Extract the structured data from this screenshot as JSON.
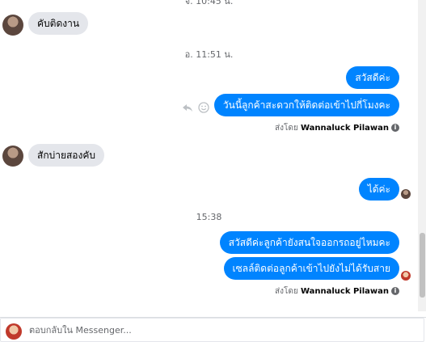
{
  "messages": {
    "top_timestamp": "จ. 10:45 น.",
    "msg1": "คับติดงาน",
    "ts1": "อ. 11:51 น.",
    "msg2": "สวัสดีค่ะ",
    "msg3": "วันนี้ลูกค้าสะดวกให้ติดต่อเข้าไปกี่โมงคะ",
    "sent_by1_prefix": "ส่งโดย",
    "sent_by1_name": "Wannaluck Pilawan",
    "msg4": "สักบ่ายสองคับ",
    "msg5": "ได้ค่ะ",
    "ts2": "15:38",
    "msg6": "สวัสดีค่ะลูกค้ายังสนใจออกรถอยู่ไหมคะ",
    "msg7": "เซลล์ติดต่อลูกค้าเข้าไปยังไม่ได้รับสาย",
    "sent_by2_prefix": "ส่งโดย",
    "sent_by2_name": "Wannaluck Pilawan"
  },
  "icons": {
    "reply": "reply-icon",
    "react": "smiley-icon",
    "info": "info-icon"
  },
  "composer": {
    "placeholder": "ตอบกลับใน Messenger..."
  },
  "colors": {
    "outgoing": "#0084ff",
    "incoming": "#e4e6eb"
  }
}
